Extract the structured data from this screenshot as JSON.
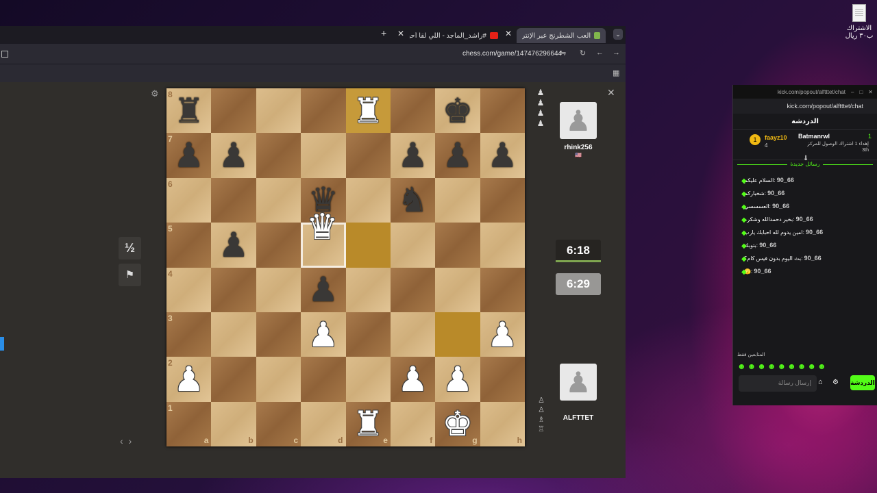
{
  "desktop": {
    "file_label": "الاشتراك ب٣٠ ريال"
  },
  "browser": {
    "tabs": [
      {
        "title": "العب الشطرنج عبر الإنترنت مجانًا"
      },
      {
        "title": "#راشد_الماجد - اللي لقا أحبابه"
      }
    ],
    "new_tab": "+",
    "url": "chess.com/game/147476296644"
  },
  "game": {
    "draw_label": "½",
    "board": [
      [
        "r",
        "",
        "",
        "",
        "R",
        "",
        "k",
        ""
      ],
      [
        "p",
        "p",
        "",
        "",
        "",
        "p",
        "p",
        "p"
      ],
      [
        "",
        "",
        "",
        "q",
        "",
        "n",
        "",
        ""
      ],
      [
        "",
        "p",
        "",
        "",
        "",
        "",
        "",
        ""
      ],
      [
        "",
        "",
        "",
        "p",
        "",
        "",
        "",
        ""
      ],
      [
        "",
        "",
        "",
        "P",
        "",
        "",
        "",
        "P"
      ],
      [
        "P",
        "",
        "",
        "",
        "",
        "P",
        "P",
        ""
      ],
      [
        "",
        "",
        "",
        "",
        "R",
        "",
        "K",
        ""
      ]
    ],
    "ranks": [
      "8",
      "7",
      "6",
      "5",
      "4",
      "3",
      "2",
      "1"
    ],
    "files": [
      "a",
      "b",
      "c",
      "d",
      "e",
      "f",
      "g",
      "h"
    ],
    "dragged_piece": "Q",
    "top_player": {
      "name": "rhink256",
      "flag": "🇺🇸",
      "clock": "6:18"
    },
    "bottom_player": {
      "name": "ALFTTET",
      "clock": "6:29"
    }
  },
  "chat": {
    "window_title": "kick.com/popout/alftttet/chat",
    "address": "kick.com/popout/alftttet/chat",
    "header": "الدردشة",
    "pinned": {
      "user": "Batmanrwl",
      "text": "إهداء 1 اشتراك الوصول للمركز 3th",
      "count_left": "1",
      "leader": "faayz10",
      "leader_count": "4"
    },
    "new_messages": "رسائل جديدة",
    "messages": [
      {
        "user": "66_90",
        "text": "السلام عليكم"
      },
      {
        "user": "66_90",
        "text": "شخباركم"
      },
      {
        "user": "66_90",
        "text": "العسسسي"
      },
      {
        "user": "66_90",
        "text": "بخير دحمدالله وشكره"
      },
      {
        "user": "66_90",
        "text": "امين يدوم لله احبابك يارب"
      },
      {
        "user": "66_90",
        "text": "بتوبك"
      },
      {
        "user": "66_90",
        "text": "بث اليوم بدون فيس كام؟"
      },
      {
        "user": "66_90",
        "text": "🫣"
      }
    ],
    "followers_only": "المتابعين فقط",
    "placeholder": "إرسال رسالة",
    "send": "الدردشة"
  }
}
